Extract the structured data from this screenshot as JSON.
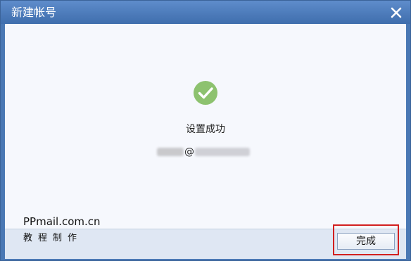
{
  "window": {
    "title": "新建帐号",
    "close_icon": "close-icon"
  },
  "main": {
    "success_icon": "check-circle-icon",
    "success_color": "#8dc26f",
    "status_text": "设置成功",
    "account": {
      "at_sign": "@"
    }
  },
  "watermark": {
    "domain": "PPmail.com.cn",
    "subtitle": "教程制作"
  },
  "footer": {
    "done_label": "完成",
    "highlight_color": "#d21f1f"
  }
}
